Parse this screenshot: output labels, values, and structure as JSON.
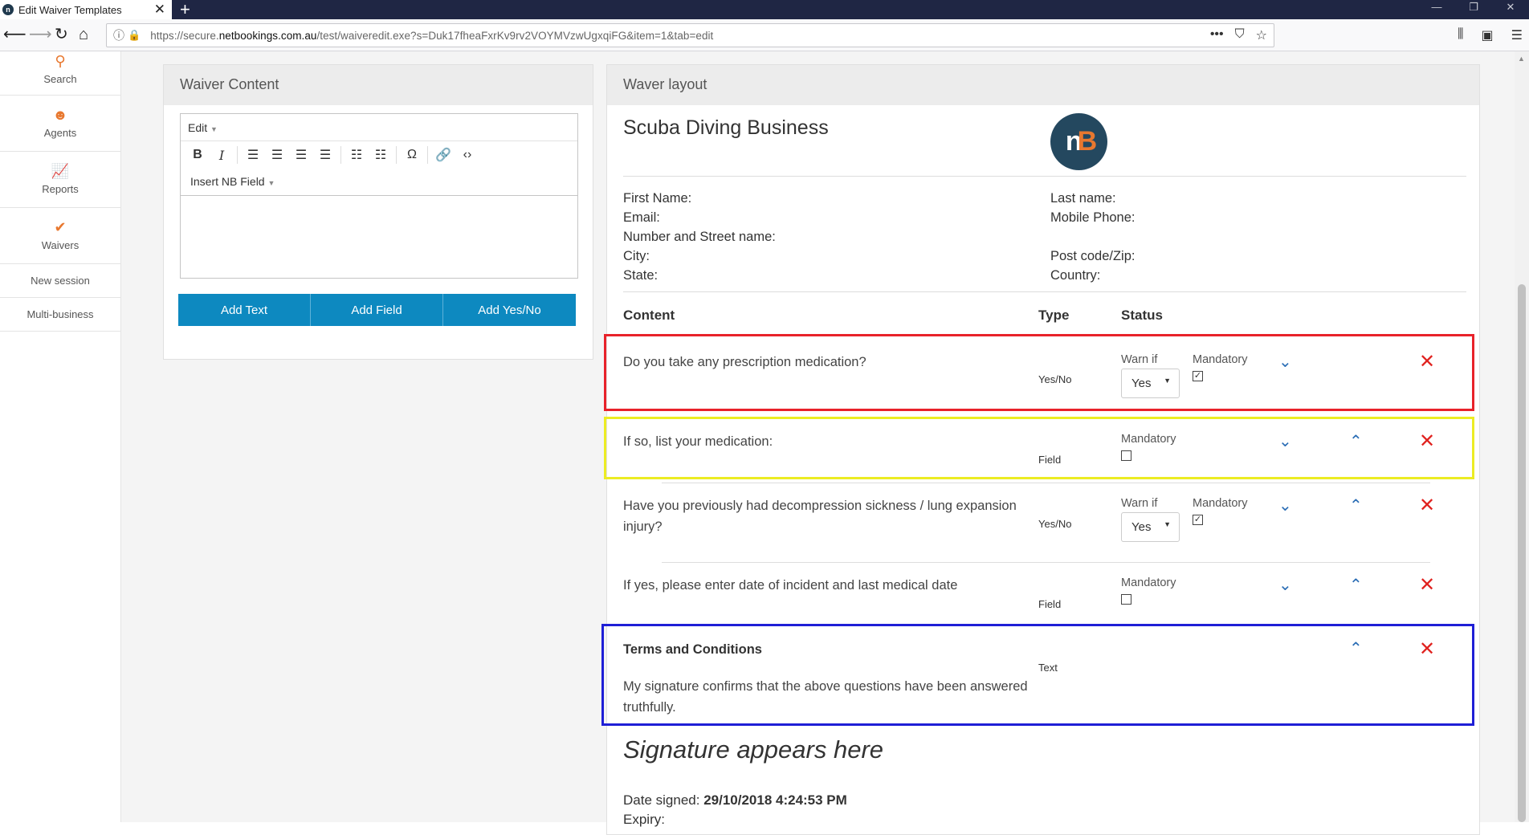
{
  "browser": {
    "tab_title": "Edit Waiver Templates",
    "url_host_prefix": "https://secure.",
    "url_domain": "netbookings.com.au",
    "url_path": "/test/waiveredit.exe?s=Duk17fheaFxrKv9rv2VOYMVzwUgxqiFG&item=1&tab=edit"
  },
  "sidebar": {
    "items": [
      {
        "label": "Search",
        "icon": "search-icon"
      },
      {
        "label": "Agents",
        "icon": "agent-icon"
      },
      {
        "label": "Reports",
        "icon": "chart-icon"
      },
      {
        "label": "Waivers",
        "icon": "check-icon"
      },
      {
        "label": "New session"
      },
      {
        "label": "Multi-business"
      }
    ]
  },
  "waiver_content": {
    "title": "Waiver Content",
    "editor_menu": "Edit",
    "insert_field": "Insert NB Field",
    "buttons": [
      "Add Text",
      "Add Field",
      "Add Yes/No"
    ]
  },
  "waiver_layout": {
    "title": "Waver layout",
    "business_name": "Scuba Diving Business",
    "logo_text": "nB",
    "fields_left": [
      "First Name:",
      "Email:",
      "Number and Street name:",
      "City:",
      "State:"
    ],
    "fields_right": [
      "Last name:",
      "Mobile Phone:",
      "Post code/Zip:",
      "Country:"
    ],
    "columns": {
      "content": "Content",
      "type": "Type",
      "status": "Status"
    },
    "rows": [
      {
        "content": "Do you take any prescription medication?",
        "type": "Yes/No",
        "warn_label": "Warn if",
        "warn_value": "Yes",
        "mandatory_label": "Mandatory",
        "mandatory": true
      },
      {
        "content": "If so, list your medication:",
        "type": "Field",
        "mandatory_label": "Mandatory",
        "mandatory": false
      },
      {
        "content": "Have you previously had decompression sickness / lung expansion injury?",
        "content_line1": "Have you previously had decompression sickness / lung expansion",
        "content_line2": "injury?",
        "type": "Yes/No",
        "warn_label": "Warn if",
        "warn_value": "Yes",
        "mandatory_label": "Mandatory",
        "mandatory": true
      },
      {
        "content": "If yes, please enter date of incident and last medical date",
        "type": "Field",
        "mandatory_label": "Mandatory",
        "mandatory": false
      },
      {
        "title": "Terms and Conditions",
        "content_line1": "My signature confirms that the above questions have been answered",
        "content_line2": "truthfully.",
        "type": "Text"
      }
    ],
    "signature": "Signature appears here",
    "date_label": "Date signed:",
    "date_value": "29/10/2018 4:24:53 PM",
    "expiry_label": "Expiry:"
  },
  "colors": {
    "accent_button": "#0d89c0",
    "delete": "#e0221f",
    "move": "#2a6db5",
    "highlight_red": "#e8222a",
    "highlight_yellow": "#ecec23",
    "highlight_blue": "#1f1fd6"
  }
}
